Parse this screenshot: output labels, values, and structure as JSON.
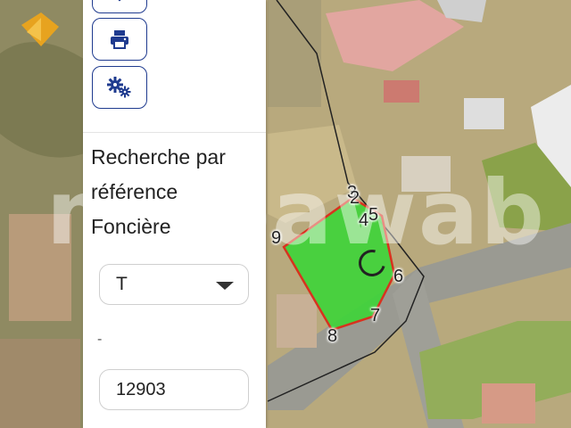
{
  "panel": {
    "section_title": "Recherche par référence Foncière",
    "select_value": "T",
    "separator": "-",
    "input_value": "12903"
  },
  "map": {
    "watermark": "mubawab",
    "parcel_fill": "#3fd43a",
    "parcel_stroke": "#d8321e",
    "vertex_labels": [
      "3",
      "2",
      "4",
      "5",
      "9",
      "6",
      "7",
      "8"
    ]
  },
  "icons": {
    "top_button": "navigate-icon",
    "print_button": "printer-icon",
    "settings_button": "gears-icon",
    "map_corner": "north-arrow-icon"
  },
  "colors": {
    "accent": "#1f3b8f",
    "panel_bg": "#ffffff"
  }
}
